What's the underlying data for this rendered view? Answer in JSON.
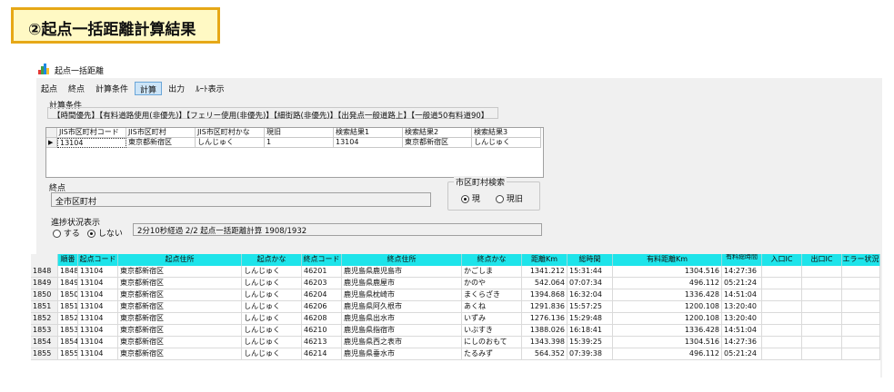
{
  "banner": {
    "title": "②起点一括距離計算結果"
  },
  "window": {
    "title": "起点一括距離"
  },
  "menu": [
    "起点",
    "終点",
    "計算条件",
    "計算",
    "出力",
    "ﾙｰﾄ表示"
  ],
  "calc_conditions": {
    "label": "計算条件",
    "text": "【時間優先】【有料道路使用(非優先)】【フェリー使用(非優先)】【細街路(非優先)】【出発点一般道路上】【一般道50有料道90】"
  },
  "start_grid": {
    "columns": [
      "JIS市区町村コード",
      "JIS市区町村",
      "JIS市区町村かな",
      "現旧",
      "検索結果1",
      "検索結果2",
      "検索結果3"
    ],
    "row": [
      "13104",
      "東京都新宿区",
      "しんじゅく",
      "1",
      "13104",
      "東京都新宿区",
      "しんじゅく"
    ]
  },
  "endpoint": {
    "label": "終点",
    "value": "全市区町村"
  },
  "municipality_search": {
    "label": "市区町村検索",
    "option_current": "現",
    "option_old": "現旧"
  },
  "progress": {
    "label": "進捗状況表示",
    "option_yes": "する",
    "option_no": "しない",
    "status": "2分10秒経過 2/2 起点一括距離計算 1908/1932"
  },
  "result_grid": {
    "columns": [
      "順番",
      "起点コード",
      "起点住所",
      "起点かな",
      "終点コード",
      "終点住所",
      "終点かな",
      "距離Km",
      "総時間",
      "有料距離Km",
      "有料総時間",
      "入口IC",
      "出口IC",
      "エラー状況"
    ],
    "rows": [
      [
        "1848",
        "1848",
        "13104",
        "東京都新宿区",
        "しんじゅく",
        "46201",
        "鹿児島県鹿児島市",
        "かごしま",
        "1341.212",
        "15:31:44",
        "1304.516",
        "14:27:36",
        "",
        "",
        ""
      ],
      [
        "1849",
        "1849",
        "13104",
        "東京都新宿区",
        "しんじゅく",
        "46203",
        "鹿児島県鹿屋市",
        "かのや",
        "542.064",
        "07:07:34",
        "496.112",
        "05:21:24",
        "",
        "",
        ""
      ],
      [
        "1850",
        "1850",
        "13104",
        "東京都新宿区",
        "しんじゅく",
        "46204",
        "鹿児島県枕崎市",
        "まくらざき",
        "1394.868",
        "16:32:04",
        "1336.428",
        "14:51:04",
        "",
        "",
        ""
      ],
      [
        "1851",
        "1851",
        "13104",
        "東京都新宿区",
        "しんじゅく",
        "46206",
        "鹿児島県阿久根市",
        "あくね",
        "1291.836",
        "15:57:25",
        "1200.108",
        "13:20:40",
        "",
        "",
        ""
      ],
      [
        "1852",
        "1852",
        "13104",
        "東京都新宿区",
        "しんじゅく",
        "46208",
        "鹿児島県出水市",
        "いずみ",
        "1276.136",
        "15:29:48",
        "1200.108",
        "13:20:40",
        "",
        "",
        ""
      ],
      [
        "1853",
        "1853",
        "13104",
        "東京都新宿区",
        "しんじゅく",
        "46210",
        "鹿児島県指宿市",
        "いぶすき",
        "1388.026",
        "16:18:41",
        "1336.428",
        "14:51:04",
        "",
        "",
        ""
      ],
      [
        "1854",
        "1854",
        "13104",
        "東京都新宿区",
        "しんじゅく",
        "46213",
        "鹿児島県西之表市",
        "にしのおもて",
        "1343.398",
        "15:39:25",
        "1304.516",
        "14:27:36",
        "",
        "",
        ""
      ],
      [
        "1855",
        "1855",
        "13104",
        "東京都新宿区",
        "しんじゅく",
        "46214",
        "鹿児島県垂水市",
        "たるみず",
        "564.352",
        "07:39:38",
        "496.112",
        "05:21:24",
        "",
        "",
        ""
      ]
    ]
  }
}
